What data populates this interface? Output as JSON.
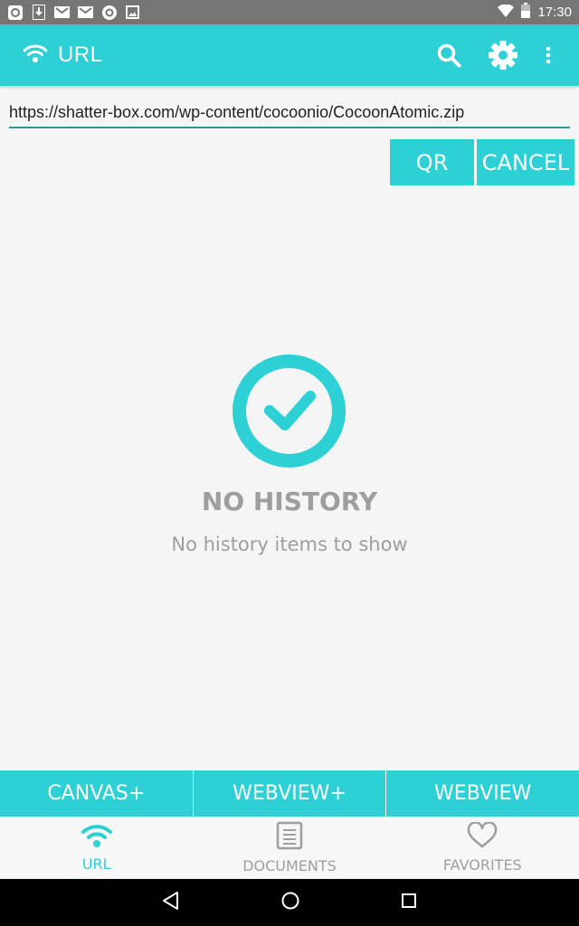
{
  "status_bar": {
    "time": "17:30",
    "icons": [
      "app-icon",
      "download-icon",
      "gmail-icon",
      "gmail-icon",
      "app-icon",
      "image-icon",
      "wifi-icon",
      "battery-icon"
    ]
  },
  "app_bar": {
    "title": "URL",
    "icons": [
      "wifi-icon",
      "search-icon",
      "gear-icon",
      "more-vert-icon"
    ]
  },
  "url_field": {
    "value": "https://shatter-box.com/wp-content/cocoonio/CocoonAtomic.zip"
  },
  "actions": {
    "qr_label": "QR",
    "cancel_label": "CANCEL"
  },
  "empty_state": {
    "title": "NO HISTORY",
    "subtitle": "No history items to show",
    "icon": "check-circle-icon"
  },
  "mode_bar": {
    "items": [
      {
        "label": "CANVAS+"
      },
      {
        "label": "WEBVIEW+"
      },
      {
        "label": "WEBVIEW"
      }
    ]
  },
  "bottom_nav": {
    "items": [
      {
        "label": "URL",
        "icon": "wifi-icon",
        "active": true
      },
      {
        "label": "DOCUMENTS",
        "icon": "document-icon",
        "active": false
      },
      {
        "label": "FAVORITES",
        "icon": "heart-icon",
        "active": false
      }
    ]
  },
  "colors": {
    "accent": "#2dd0d5",
    "status_bar": "#757575",
    "text_muted": "#9e9e9e",
    "underline": "#2a9d99"
  }
}
